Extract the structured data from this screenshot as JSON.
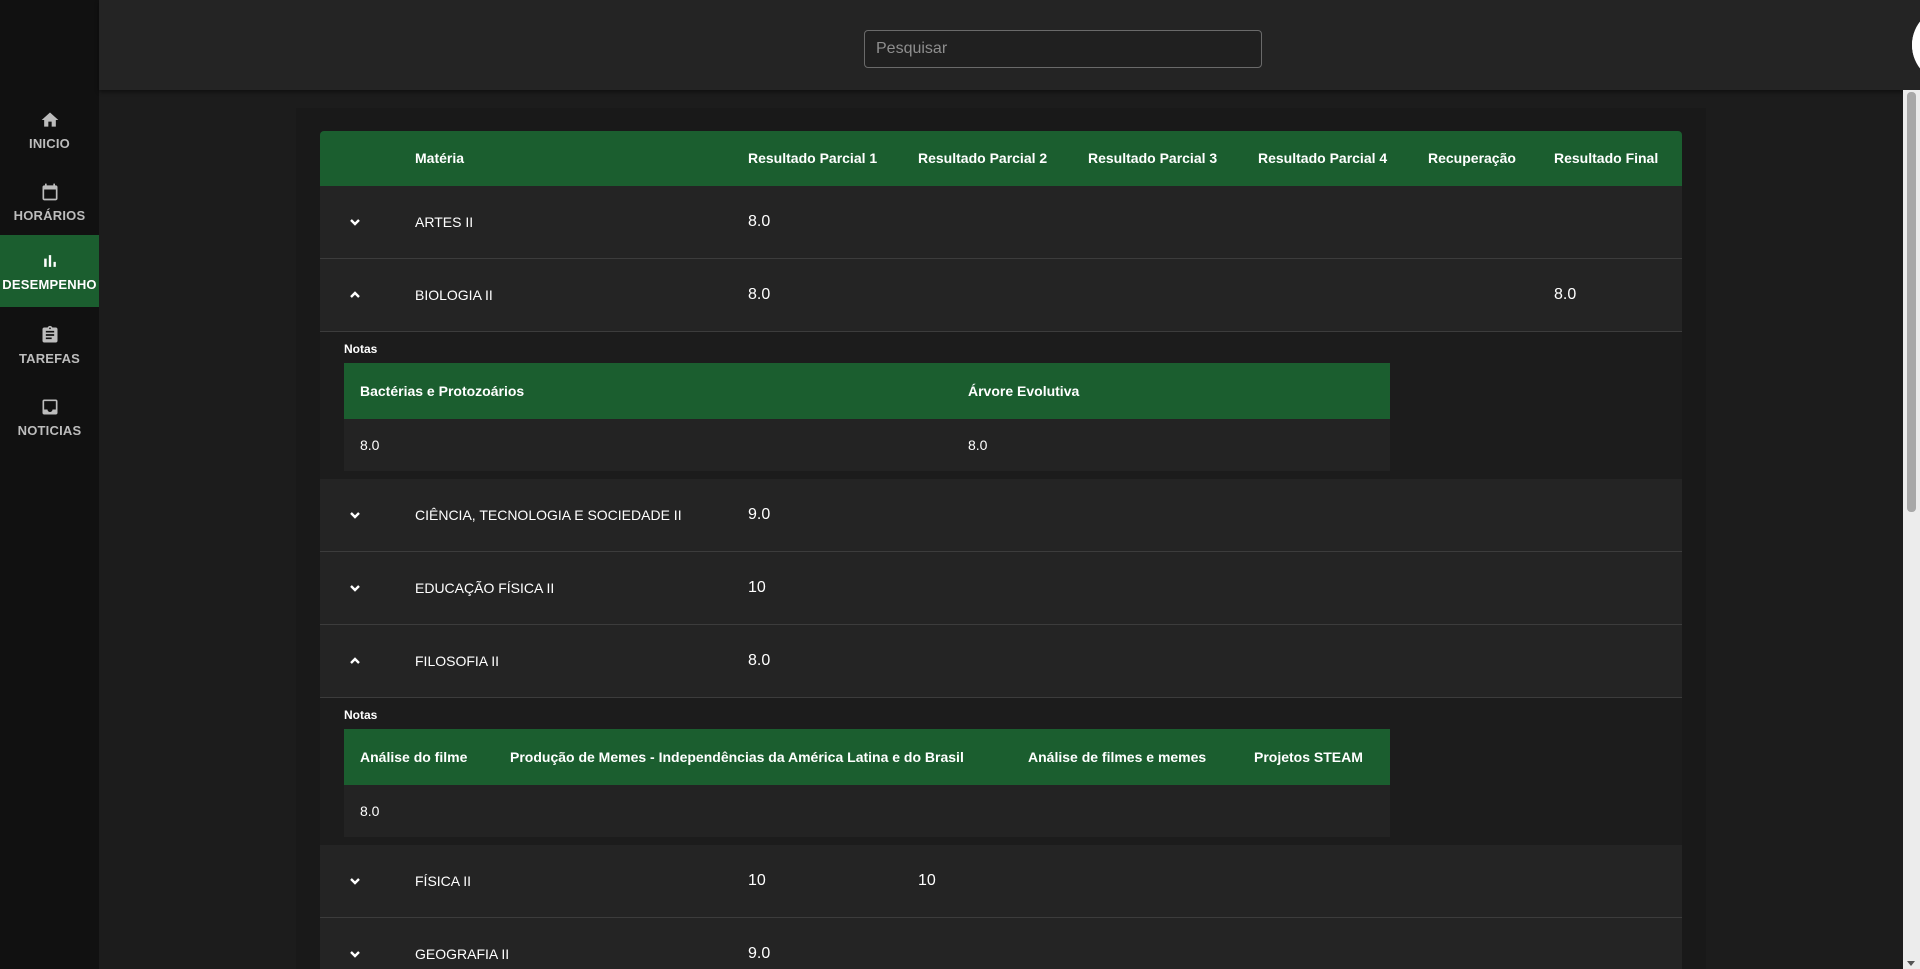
{
  "search": {
    "placeholder": "Pesquisar",
    "value": ""
  },
  "sidebar": {
    "items": [
      {
        "label": "INICIO",
        "icon": "home-icon",
        "active": false
      },
      {
        "label": "HORÁRIOS",
        "icon": "calendar-icon",
        "active": false
      },
      {
        "label": "DESEMPENHO",
        "icon": "bar-chart-icon",
        "active": true
      },
      {
        "label": "TAREFAS",
        "icon": "clipboard-icon",
        "active": false
      },
      {
        "label": "NOTICIAS",
        "icon": "inbox-icon",
        "active": false
      }
    ]
  },
  "colors": {
    "accent": "#1b5e2f",
    "background": "#1c1c1c",
    "row": "#242424"
  },
  "table": {
    "headers": [
      "Matéria",
      "Resultado Parcial 1",
      "Resultado Parcial 2",
      "Resultado Parcial 3",
      "Resultado Parcial 4",
      "Recuperação",
      "Resultado Final"
    ],
    "rows": [
      {
        "subject": "ARTES II",
        "expanded": false,
        "p1": "8.0",
        "p2": "",
        "p3": "",
        "p4": "",
        "rec": "",
        "final": ""
      },
      {
        "subject": "BIOLOGIA II",
        "expanded": true,
        "p1": "8.0",
        "p2": "",
        "p3": "",
        "p4": "",
        "rec": "",
        "final": "8.0",
        "notes": {
          "label": "Notas",
          "headers": [
            "Bactérias e Protozoários",
            "Árvore Evolutiva"
          ],
          "values": [
            "8.0",
            "8.0"
          ]
        }
      },
      {
        "subject": "CIÊNCIA, TECNOLOGIA E SOCIEDADE II",
        "expanded": false,
        "p1": "9.0",
        "p2": "",
        "p3": "",
        "p4": "",
        "rec": "",
        "final": ""
      },
      {
        "subject": "EDUCAÇÃO FÍSICA II",
        "expanded": false,
        "p1": "10",
        "p2": "",
        "p3": "",
        "p4": "",
        "rec": "",
        "final": ""
      },
      {
        "subject": "FILOSOFIA II",
        "expanded": true,
        "p1": "8.0",
        "p2": "",
        "p3": "",
        "p4": "",
        "rec": "",
        "final": "",
        "notes": {
          "label": "Notas",
          "headers": [
            "Análise do filme",
            "Produção de Memes - Independências da América Latina e do Brasil",
            "Análise de filmes e memes",
            "Projetos STEAM"
          ],
          "values": [
            "8.0",
            "",
            "",
            ""
          ]
        }
      },
      {
        "subject": "FÍSICA II",
        "expanded": false,
        "p1": "10",
        "p2": "10",
        "p3": "",
        "p4": "",
        "rec": "",
        "final": ""
      },
      {
        "subject": "GEOGRAFIA II",
        "expanded": false,
        "p1": "9.0",
        "p2": "",
        "p3": "",
        "p4": "",
        "rec": "",
        "final": ""
      }
    ]
  }
}
